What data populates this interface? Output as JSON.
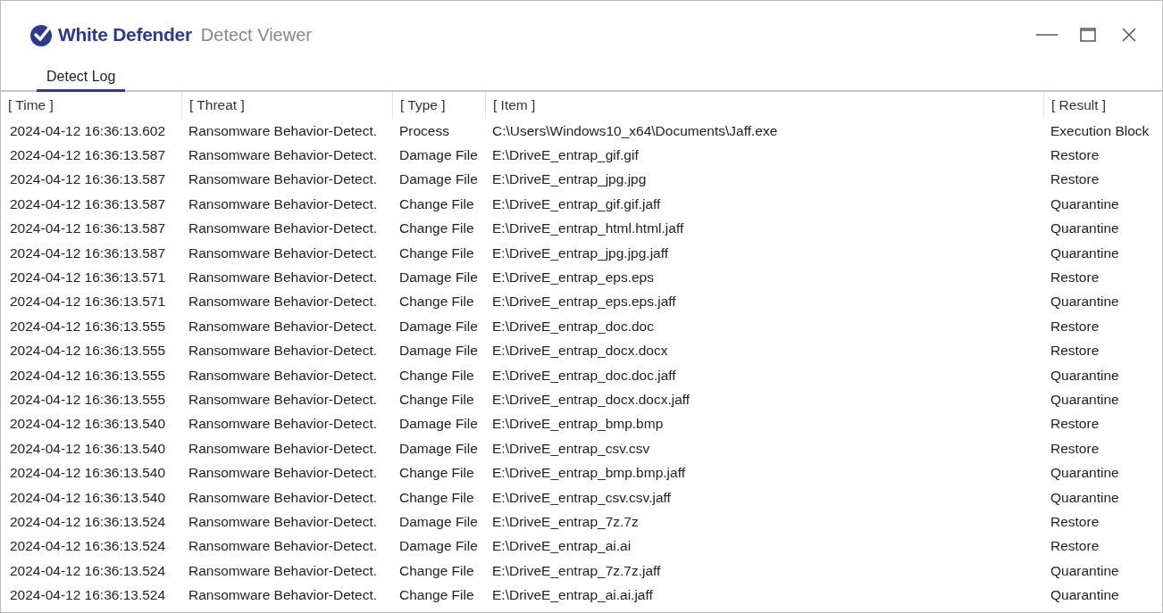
{
  "window": {
    "brand": "White Defender",
    "title": "Detect Viewer"
  },
  "tabs": [
    {
      "label": "Detect Log",
      "selected": true
    }
  ],
  "table": {
    "columns": [
      "[ Time ]",
      "[ Threat ]",
      "[ Type ]",
      "[ Item ]",
      "[ Result ]"
    ],
    "rows": [
      [
        "2024-04-12 16:36:13.602",
        "Ransomware Behavior-Detect.",
        "Process",
        "C:\\Users\\Windows10_x64\\Documents\\Jaff.exe",
        "Execution Block"
      ],
      [
        "2024-04-12 16:36:13.587",
        "Ransomware Behavior-Detect.",
        "Damage File",
        "E:\\DriveE_entrap_gif.gif",
        "Restore"
      ],
      [
        "2024-04-12 16:36:13.587",
        "Ransomware Behavior-Detect.",
        "Damage File",
        "E:\\DriveE_entrap_jpg.jpg",
        "Restore"
      ],
      [
        "2024-04-12 16:36:13.587",
        "Ransomware Behavior-Detect.",
        "Change File",
        "E:\\DriveE_entrap_gif.gif.jaff",
        "Quarantine"
      ],
      [
        "2024-04-12 16:36:13.587",
        "Ransomware Behavior-Detect.",
        "Change File",
        "E:\\DriveE_entrap_html.html.jaff",
        "Quarantine"
      ],
      [
        "2024-04-12 16:36:13.587",
        "Ransomware Behavior-Detect.",
        "Change File",
        "E:\\DriveE_entrap_jpg.jpg.jaff",
        "Quarantine"
      ],
      [
        "2024-04-12 16:36:13.571",
        "Ransomware Behavior-Detect.",
        "Damage File",
        "E:\\DriveE_entrap_eps.eps",
        "Restore"
      ],
      [
        "2024-04-12 16:36:13.571",
        "Ransomware Behavior-Detect.",
        "Change File",
        "E:\\DriveE_entrap_eps.eps.jaff",
        "Quarantine"
      ],
      [
        "2024-04-12 16:36:13.555",
        "Ransomware Behavior-Detect.",
        "Damage File",
        "E:\\DriveE_entrap_doc.doc",
        "Restore"
      ],
      [
        "2024-04-12 16:36:13.555",
        "Ransomware Behavior-Detect.",
        "Damage File",
        "E:\\DriveE_entrap_docx.docx",
        "Restore"
      ],
      [
        "2024-04-12 16:36:13.555",
        "Ransomware Behavior-Detect.",
        "Change File",
        "E:\\DriveE_entrap_doc.doc.jaff",
        "Quarantine"
      ],
      [
        "2024-04-12 16:36:13.555",
        "Ransomware Behavior-Detect.",
        "Change File",
        "E:\\DriveE_entrap_docx.docx.jaff",
        "Quarantine"
      ],
      [
        "2024-04-12 16:36:13.540",
        "Ransomware Behavior-Detect.",
        "Damage File",
        "E:\\DriveE_entrap_bmp.bmp",
        "Restore"
      ],
      [
        "2024-04-12 16:36:13.540",
        "Ransomware Behavior-Detect.",
        "Damage File",
        "E:\\DriveE_entrap_csv.csv",
        "Restore"
      ],
      [
        "2024-04-12 16:36:13.540",
        "Ransomware Behavior-Detect.",
        "Change File",
        "E:\\DriveE_entrap_bmp.bmp.jaff",
        "Quarantine"
      ],
      [
        "2024-04-12 16:36:13.540",
        "Ransomware Behavior-Detect.",
        "Change File",
        "E:\\DriveE_entrap_csv.csv.jaff",
        "Quarantine"
      ],
      [
        "2024-04-12 16:36:13.524",
        "Ransomware Behavior-Detect.",
        "Damage File",
        "E:\\DriveE_entrap_7z.7z",
        "Restore"
      ],
      [
        "2024-04-12 16:36:13.524",
        "Ransomware Behavior-Detect.",
        "Damage File",
        "E:\\DriveE_entrap_ai.ai",
        "Restore"
      ],
      [
        "2024-04-12 16:36:13.524",
        "Ransomware Behavior-Detect.",
        "Change File",
        "E:\\DriveE_entrap_7z.7z.jaff",
        "Quarantine"
      ],
      [
        "2024-04-12 16:36:13.524",
        "Ransomware Behavior-Detect.",
        "Change File",
        "E:\\DriveE_entrap_ai.ai.jaff",
        "Quarantine"
      ]
    ]
  }
}
